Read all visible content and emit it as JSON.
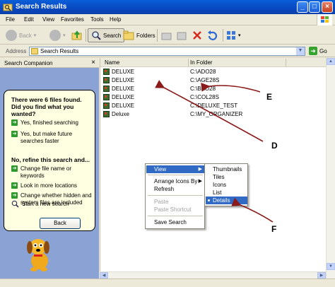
{
  "window": {
    "title": "Search Results",
    "minimize": "_",
    "maximize": "□",
    "close": "×"
  },
  "menu": [
    "File",
    "Edit",
    "View",
    "Favorites",
    "Tools",
    "Help"
  ],
  "toolbar": {
    "back": "Back",
    "search": "Search",
    "folders": "Folders",
    "views_dd": "▾"
  },
  "address": {
    "label": "Address",
    "value": "Search Results",
    "go": "Go"
  },
  "companion": {
    "title": "Search Companion",
    "question": "There were 6 files found. Did you find what you wanted?",
    "options_top": [
      "Yes, finished searching",
      "Yes, but make future searches faster"
    ],
    "refine_title": "No, refine this search and...",
    "options_refine": [
      "Change file name or keywords",
      "Look in more locations",
      "Change whether hidden and system files are included"
    ],
    "new_search": "Start a new search",
    "back_button": "Back"
  },
  "list": {
    "headers": [
      "Name",
      "In Folder"
    ],
    "rows": [
      {
        "name": "DELUXE",
        "folder": "C:\\ADO28"
      },
      {
        "name": "DELUXE",
        "folder": "C:\\AGE28S"
      },
      {
        "name": "DELUXE",
        "folder": "C:\\BKO28"
      },
      {
        "name": "DELUXE",
        "folder": "C:\\COL28S"
      },
      {
        "name": "DELUXE",
        "folder": "C:\\DELUXE_TEST"
      },
      {
        "name": "Deluxe",
        "folder": "C:\\MY_ORGANIZER"
      }
    ]
  },
  "context_menu": {
    "items": [
      "View",
      "Arrange Icons By",
      "Refresh",
      "Paste",
      "Paste Shortcut",
      "Save Search"
    ],
    "highlighted": "View"
  },
  "view_submenu": {
    "items": [
      "Thumbnails",
      "Tiles",
      "Icons",
      "List",
      "Details"
    ],
    "selected": "Details"
  },
  "annotations": {
    "d": "D",
    "e": "E",
    "f": "F"
  },
  "colors": {
    "titlebar": "#0a5fd8",
    "highlight": "#316ac5",
    "companion_bg": "#8aa3d4",
    "balloon": "#ffffe1",
    "annotation_arrow": "#8b1a1a"
  }
}
